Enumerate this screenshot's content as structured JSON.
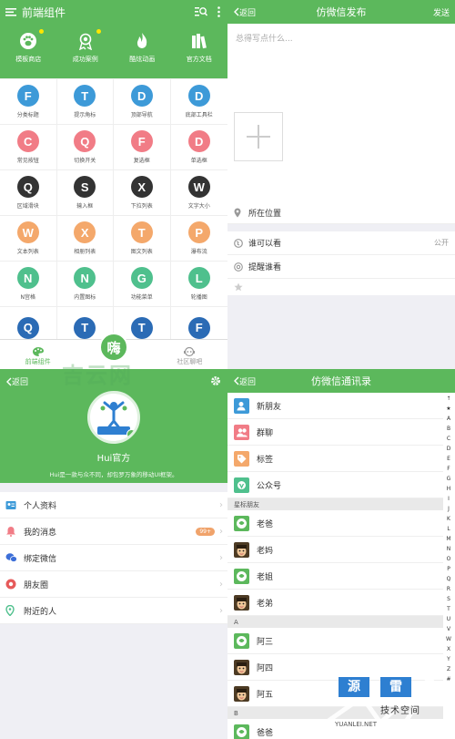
{
  "components_screen": {
    "title": "前端组件",
    "features": [
      {
        "label": "模板商店",
        "icon": "paw-icon",
        "badge": true
      },
      {
        "label": "成功案例",
        "icon": "medal-icon",
        "badge": true
      },
      {
        "label": "酷炫动画",
        "icon": "fire-icon",
        "badge": false
      },
      {
        "label": "官方文档",
        "icon": "books-icon",
        "badge": false
      }
    ],
    "grid": [
      {
        "letter": "F",
        "label": "分类标题",
        "color": "#3d9ad8"
      },
      {
        "letter": "T",
        "label": "提示角标",
        "color": "#3d9ad8"
      },
      {
        "letter": "D",
        "label": "顶部导航",
        "color": "#3d9ad8"
      },
      {
        "letter": "D",
        "label": "底部工具栏",
        "color": "#3d9ad8"
      },
      {
        "letter": "C",
        "label": "常见按钮",
        "color": "#f17c86"
      },
      {
        "letter": "Q",
        "label": "切换开关",
        "color": "#f17c86"
      },
      {
        "letter": "F",
        "label": "复选框",
        "color": "#f17c86"
      },
      {
        "letter": "D",
        "label": "单选框",
        "color": "#f17c86"
      },
      {
        "letter": "Q",
        "label": "区域滑块",
        "color": "#333333"
      },
      {
        "letter": "S",
        "label": "输入框",
        "color": "#333333"
      },
      {
        "letter": "X",
        "label": "下拉列表",
        "color": "#333333"
      },
      {
        "letter": "W",
        "label": "文字大小",
        "color": "#333333"
      },
      {
        "letter": "W",
        "label": "文本列表",
        "color": "#f4a86b"
      },
      {
        "letter": "X",
        "label": "相册列表",
        "color": "#f4a86b"
      },
      {
        "letter": "T",
        "label": "图文列表",
        "color": "#f4a86b"
      },
      {
        "letter": "P",
        "label": "瀑布流",
        "color": "#f4a86b"
      },
      {
        "letter": "N",
        "label": "N宫格",
        "color": "#4fc08d"
      },
      {
        "letter": "N",
        "label": "内置图标",
        "color": "#4fc08d"
      },
      {
        "letter": "G",
        "label": "功能菜单",
        "color": "#4fc08d"
      },
      {
        "letter": "L",
        "label": "轮播图",
        "color": "#4fc08d"
      },
      {
        "letter": "Q",
        "label": "",
        "color": "#2b6bb5"
      },
      {
        "letter": "T",
        "label": "",
        "color": "#2b6bb5"
      },
      {
        "letter": "T",
        "label": "",
        "color": "#2b6bb5"
      },
      {
        "letter": "F",
        "label": "",
        "color": "#2b6bb5"
      }
    ],
    "tabs": [
      {
        "label": "前端组件",
        "active": true
      },
      {
        "label": "",
        "active": false
      },
      {
        "label": "社区聊吧",
        "active": false
      }
    ],
    "center_glyph": "嗨"
  },
  "post_screen": {
    "back": "返回",
    "title": "仿微信发布",
    "action": "发送",
    "placeholder": "总得写点什么...",
    "location": "所在位置",
    "visibility_label": "谁可以看",
    "visibility_value": "公开",
    "remind": "提醒谁看"
  },
  "profile_screen": {
    "back": "返回",
    "name": "Hui官方",
    "desc": "Hui是一款与众不同，却包罗万象的移动UI框架。",
    "menu": [
      {
        "label": "个人资料",
        "icon": "id-card-icon",
        "color": "#3d9ad8"
      },
      {
        "label": "我的消息",
        "icon": "bell-icon",
        "color": "#f17c86",
        "badge": "99+"
      },
      {
        "label": "绑定微信",
        "icon": "wechat-icon",
        "color": "#3d6fd8"
      },
      {
        "label": "朋友圈",
        "icon": "aperture-icon",
        "color": "#e65a5a"
      },
      {
        "label": "附近的人",
        "icon": "map-pin-icon",
        "color": "#4fc08d"
      }
    ]
  },
  "contacts_screen": {
    "back": "返回",
    "title": "仿微信通讯录",
    "top": [
      {
        "label": "新朋友",
        "color": "#3d9ad8",
        "icon": "add-friend-icon"
      },
      {
        "label": "群聊",
        "color": "#f17c86",
        "icon": "group-icon"
      },
      {
        "label": "标签",
        "color": "#f4a86b",
        "icon": "tag-icon"
      },
      {
        "label": "公众号",
        "color": "#4fc08d",
        "icon": "official-account-icon"
      }
    ],
    "sections": [
      {
        "title": "星标朋友",
        "items": [
          {
            "name": "老爸",
            "avatar": "green"
          },
          {
            "name": "老妈",
            "avatar": "face"
          },
          {
            "name": "老姐",
            "avatar": "green"
          },
          {
            "name": "老弟",
            "avatar": "face"
          }
        ]
      },
      {
        "title": "A",
        "items": [
          {
            "name": "阿三",
            "avatar": "green"
          },
          {
            "name": "阿四",
            "avatar": "face"
          },
          {
            "name": "阿五",
            "avatar": "face"
          }
        ]
      },
      {
        "title": "B",
        "items": [
          {
            "name": "爸爸",
            "avatar": "green"
          }
        ]
      }
    ],
    "index": [
      "↑",
      "★",
      "A",
      "B",
      "C",
      "D",
      "E",
      "F",
      "G",
      "H",
      "I",
      "J",
      "K",
      "L",
      "M",
      "N",
      "O",
      "P",
      "Q",
      "R",
      "S",
      "T",
      "U",
      "V",
      "W",
      "X",
      "Y",
      "Z",
      "#"
    ]
  },
  "watermarks": {
    "site": "吉云网",
    "brand_a": "源",
    "brand_b": "雷",
    "brand_sub": "技术空间",
    "brand_url": "YUANLEI.NET"
  },
  "theme": {
    "green": "#5cb85c"
  }
}
